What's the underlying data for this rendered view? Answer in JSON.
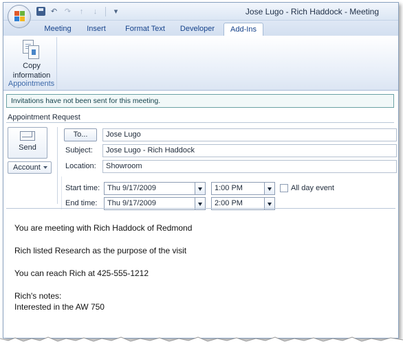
{
  "window": {
    "title": "Jose Lugo - Rich Haddock - Meeting"
  },
  "tabs": [
    {
      "label": "Meeting"
    },
    {
      "label": "Insert"
    },
    {
      "label": "Format Text"
    },
    {
      "label": "Developer"
    },
    {
      "label": "Add-Ins",
      "active": true
    }
  ],
  "ribbon": {
    "copy_button_line1": "Copy",
    "copy_button_line2": "information",
    "group_label": "Appointments"
  },
  "infobar": {
    "text": "Invitations have not been sent for this meeting."
  },
  "appointment_label": "Appointment Request",
  "send": {
    "label": "Send"
  },
  "account": {
    "label": "Account"
  },
  "fields": {
    "to_button": "To...",
    "to_value": "Jose Lugo",
    "subject_label": "Subject:",
    "subject_value": "Jose Lugo - Rich Haddock",
    "location_label": "Location:",
    "location_value": "Showroom",
    "start_label": "Start time:",
    "start_date": "Thu 9/17/2009",
    "start_time": "1:00 PM",
    "end_label": "End time:",
    "end_date": "Thu 9/17/2009",
    "end_time": "2:00 PM",
    "all_day_label": "All day event",
    "all_day_checked": false
  },
  "body": {
    "line1": "You are meeting with Rich Haddock of Redmond",
    "line2": "Rich listed Research as the purpose of the visit",
    "line3": "You can reach Rich at 425-555-1212",
    "line4": "Rich's notes:",
    "line5": "Interested in the AW 750"
  },
  "colors": {
    "accent": "#15428b",
    "infobar_border": "#6aa1a3"
  }
}
